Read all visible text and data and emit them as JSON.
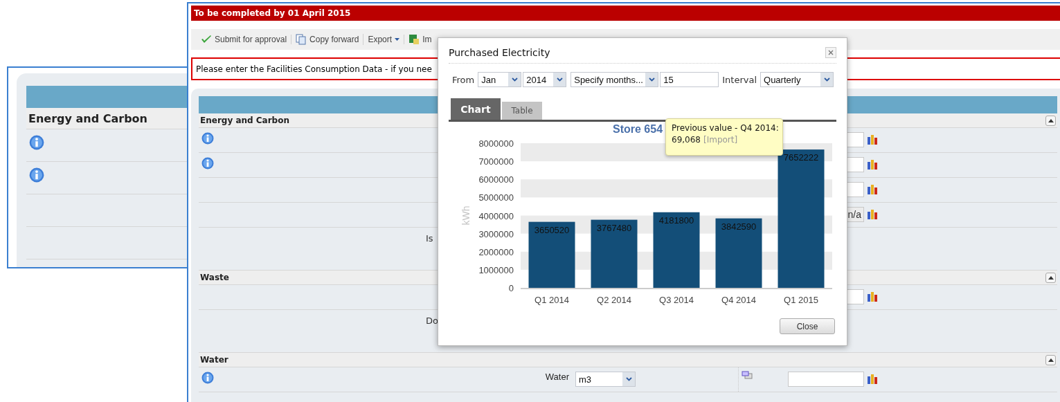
{
  "back_window": {
    "sections": [
      {
        "title": "Energy and Carbon",
        "rows": [
          {
            "info": true
          },
          {
            "info": true
          },
          {
            "info": false
          },
          {
            "info": false
          }
        ]
      }
    ]
  },
  "front_window": {
    "deadline_banner": "To be completed by 01 April 2015",
    "toolbar": [
      {
        "kind": "submit",
        "label": "Submit for approval"
      },
      {
        "kind": "copy",
        "label": "Copy forward"
      },
      {
        "kind": "export",
        "label": "Export"
      },
      {
        "kind": "import",
        "label": "Im"
      }
    ],
    "notice": "Please enter the Facilities Consumption Data - if you nee",
    "sections": [
      {
        "title": "Energy and Carbon",
        "rows": [
          {
            "kind": "field",
            "info": true,
            "field": {
              "disabled": false
            }
          },
          {
            "kind": "field",
            "info": true,
            "field": {
              "disabled": false
            }
          },
          {
            "kind": "field",
            "info": false,
            "field": {
              "disabled": false
            }
          },
          {
            "kind": "field",
            "info": false,
            "field": {
              "value": "n/a",
              "disabled": true
            }
          },
          {
            "kind": "question",
            "info": false,
            "text": "Is"
          }
        ]
      },
      {
        "title": "Waste",
        "rows": [
          {
            "kind": "field",
            "info": false,
            "field": {
              "disabled": false
            }
          },
          {
            "kind": "question",
            "info": false,
            "text": "Do"
          }
        ]
      },
      {
        "title": "Water",
        "rows": [
          {
            "kind": "field",
            "info": true,
            "label": "Water",
            "unit": "m3",
            "linked": true,
            "field": {
              "disabled": false
            }
          }
        ]
      }
    ]
  },
  "dialog": {
    "title": "Purchased Electricity",
    "from_label": "From",
    "month": "Jan",
    "year": "2014",
    "range": "Specify months...",
    "count": "15",
    "interval_label": "Interval",
    "interval": "Quarterly",
    "tabs": [
      {
        "label": "Chart",
        "selected": true
      },
      {
        "label": "Table",
        "selected": false
      }
    ],
    "chart_data": {
      "type": "bar",
      "title": "Store 654",
      "ylabel": "kWh",
      "categories": [
        "Q1 2014",
        "Q2 2014",
        "Q3 2014",
        "Q4 2014",
        "Q1 2015"
      ],
      "series": [
        {
          "color": "#134e78",
          "values": [
            3650520,
            3767480,
            4181800,
            3842590,
            7652222
          ]
        }
      ],
      "ylim": [
        0,
        8000000
      ],
      "yticks": [
        0,
        1000000,
        2000000,
        3000000,
        4000000,
        5000000,
        6000000,
        7000000,
        8000000
      ],
      "data_labels": true
    },
    "tooltip": {
      "heading": "Previous value - Q4 2014:",
      "value": "69,068",
      "link": "[Import]"
    },
    "close_button": "Close"
  }
}
